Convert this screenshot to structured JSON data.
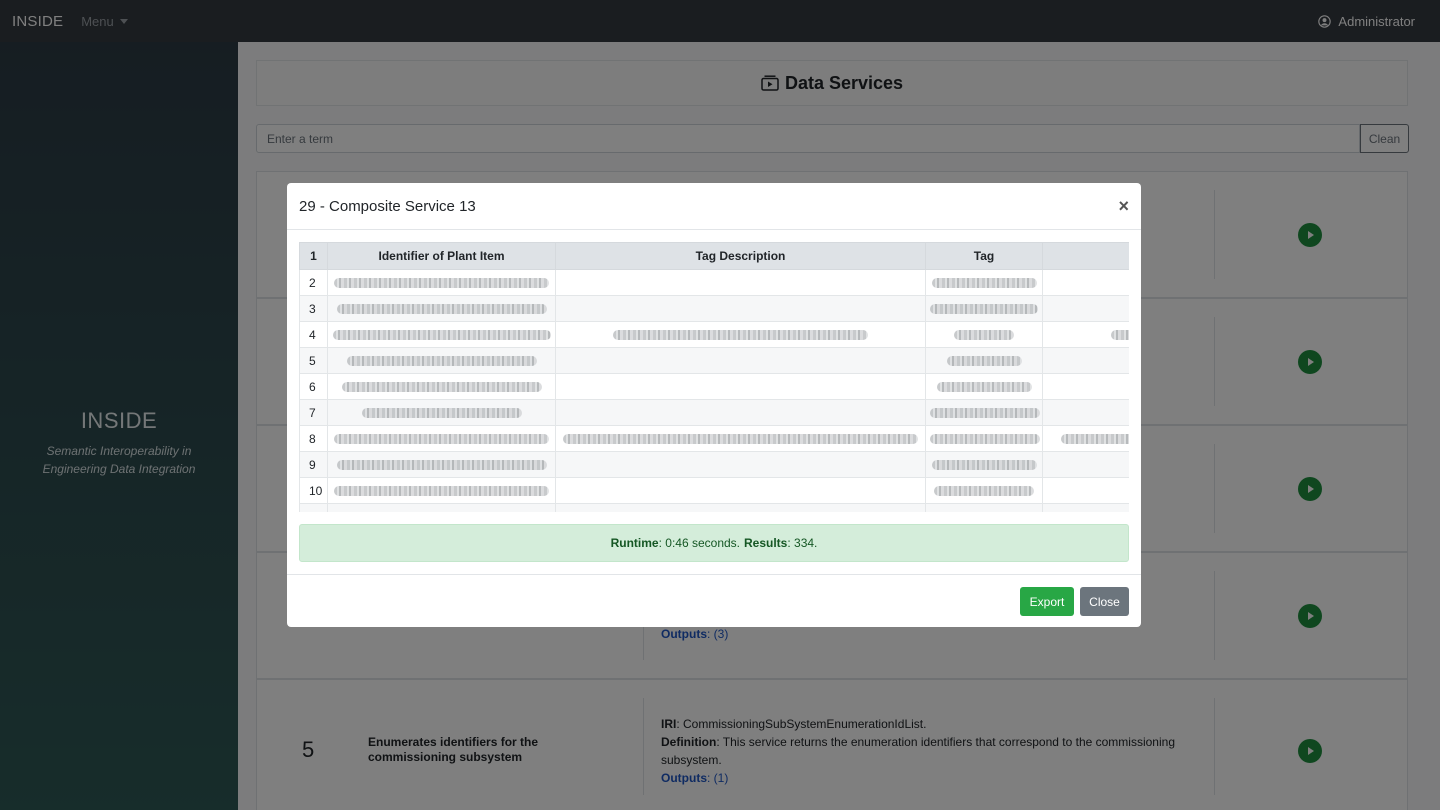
{
  "navbar": {
    "brand": "INSIDE",
    "menu": "Menu",
    "user": "Administrator"
  },
  "sidebar": {
    "title": "INSIDE",
    "subtitle_line1": "Semantic Interoperability in",
    "subtitle_line2": "Engineering Data Integration"
  },
  "page": {
    "title": "Data Services"
  },
  "search": {
    "placeholder": "Enter a term",
    "clean": "Clean"
  },
  "services": [
    {
      "number": "",
      "name": "",
      "iri_label": "",
      "iri": "",
      "def_label": "",
      "definition": "",
      "outputs_label": "",
      "outputs": ""
    },
    {
      "number": "",
      "name": "",
      "iri_label": "",
      "iri": "",
      "def_label": "",
      "definition": "",
      "outputs_label": "",
      "outputs": ""
    },
    {
      "number": "",
      "name": "",
      "iri_label": "",
      "iri": "",
      "def_label": "",
      "definition": "",
      "outputs_label": "",
      "outputs": ""
    },
    {
      "number": "",
      "name": "",
      "iri_label": "",
      "iri": "",
      "def_label": "",
      "definition": "",
      "outputs_label": "Outputs",
      "outputs": ": (3)"
    },
    {
      "number": "5",
      "name": "Enumerates identifiers for the commissioning subsystem",
      "iri_label": "IRI",
      "iri": ": CommissioningSubSystemEnumerationIdList.",
      "def_label": "Definition",
      "definition": ": This service returns the enumeration identifiers that correspond to the commissioning subsystem.",
      "outputs_label": "Outputs",
      "outputs": ": (1)"
    }
  ],
  "modal": {
    "title": "29 - Composite Service 13",
    "close_symbol": "×",
    "table": {
      "headers": [
        "1",
        "Identifier of Plant Item",
        "Tag Description",
        "Tag",
        ""
      ],
      "row_numbers": [
        "2",
        "3",
        "4",
        "5",
        "6",
        "7",
        "8",
        "9",
        "10",
        ""
      ]
    },
    "runtime_label": "Runtime",
    "runtime_value": ": 0:46 seconds.",
    "results_label": "Results",
    "results_value": ": 334.",
    "export": "Export",
    "close": "Close"
  }
}
